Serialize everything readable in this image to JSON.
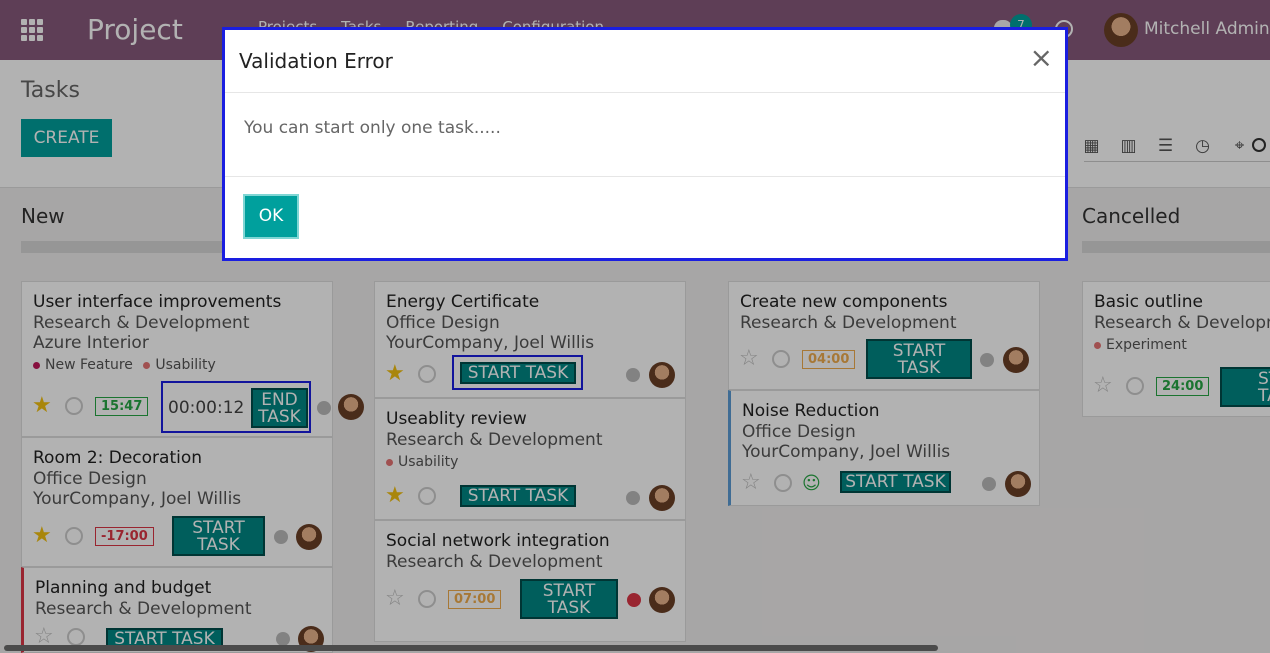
{
  "navbar": {
    "app_name": "Project",
    "menu": [
      "Projects",
      "Tasks",
      "Reporting",
      "Configuration"
    ],
    "badge": "7",
    "user": "Mitchell Admin"
  },
  "control": {
    "title": "Tasks",
    "create_label": "CREATE"
  },
  "columns": {
    "new": "New",
    "cancelled": "Cancelled"
  },
  "cards": {
    "c1": {
      "title": "User interface improvements",
      "project": "Research & Development",
      "customer": "Azure Interior",
      "tag1": "New Feature",
      "tag2": "Usability",
      "time": "15:47",
      "timer": "00:00:12",
      "btn_line1": "END",
      "btn_line2": "TASK"
    },
    "c2": {
      "title": "Room 2: Decoration",
      "project": "Office Design",
      "customer": "YourCompany, Joel Willis",
      "time": "-17:00",
      "btn_line1": "START",
      "btn_line2": "TASK"
    },
    "c3": {
      "title": "Planning and budget",
      "project": "Research & Development",
      "btn": "START TASK"
    },
    "c4": {
      "title": "Energy Certificate",
      "project": "Office Design",
      "customer": "YourCompany, Joel Willis",
      "btn": "START TASK"
    },
    "c5": {
      "title": "Useablity review",
      "project": "Research & Development",
      "tag1": "Usability",
      "btn": "START TASK"
    },
    "c6": {
      "title": "Social network integration",
      "project": "Research & Development",
      "time": "07:00",
      "btn_line1": "START",
      "btn_line2": "TASK"
    },
    "c7": {
      "title": "Create new components",
      "project": "Research & Development",
      "time": "04:00",
      "btn_line1": "START",
      "btn_line2": "TASK"
    },
    "c8": {
      "title": "Noise Reduction",
      "project": "Office Design",
      "customer": "YourCompany, Joel Willis",
      "btn": "START TASK"
    },
    "c9": {
      "title": "Basic outline",
      "project": "Research & Developm",
      "tag1": "Experiment",
      "time": "24:00",
      "btn_line1": "STA",
      "btn_line2": "TA"
    }
  },
  "dialog": {
    "title": "Validation Error",
    "close": "×",
    "message": "You can start only one task.....",
    "ok_label": "OK"
  },
  "colors": {
    "brand": "#875a7b",
    "primary": "#00a09d",
    "highlight": "#1a1ee0"
  }
}
